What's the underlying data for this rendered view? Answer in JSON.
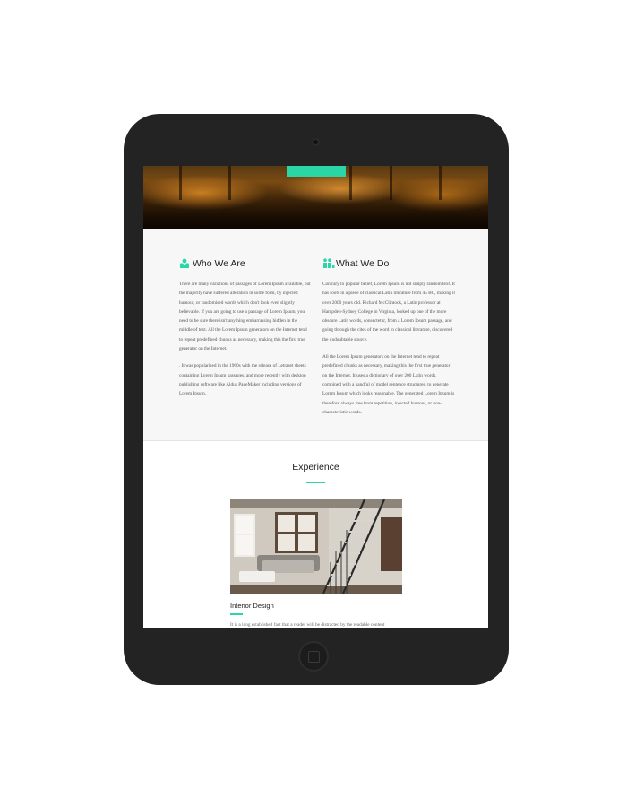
{
  "colors": {
    "accent": "#2bd6a6",
    "device": "#232323",
    "section_bg": "#f7f7f7"
  },
  "sections": {
    "who_we_are": {
      "title": "Who We Are",
      "icon": "person-icon",
      "paragraphs": [
        "There are many variations of passages of Lorem Ipsum available, but the majority have suffered alteration in some form, by injected humour, or randomised words which don't look even slightly believable. If you are going to use a passage of Lorem Ipsum, you need to be sure there isn't anything embarrassing hidden in the middle of text. All the Lorem Ipsum generators on the Internet tend to repeat predefined chunks as necessary, making this the first true generator on the Internet.",
        ". It was popularised in the 1960s with the release of Letraset sheets containing Lorem Ipsum passages, and more recently with desktop publishing software like Aldus PageMaker including versions of Lorem Ipsum."
      ]
    },
    "what_we_do": {
      "title": "What We Do",
      "icon": "team-icon",
      "paragraphs": [
        "Contrary to popular belief, Lorem Ipsum is not simply random text. It has roots in a piece of classical Latin literature from 45 BC, making it over 2000 years old. Richard McClintock, a Latin professor at Hampden-Sydney College in Virginia, looked up one of the more obscure Latin words, consectetur, from a Lorem Ipsum passage, and going through the cites of the word in classical literature, discovered the undoubtable source.",
        "All the Lorem Ipsum generators on the Internet tend to repeat predefined chunks as necessary, making this the first true generator on the Internet. It uses a dictionary of over 200 Latin words, combined with a handful of model sentence structures, to generate Lorem Ipsum which looks reasonable. The generated Lorem Ipsum is therefore always free from repetition, injected humour, or non-characteristic words."
      ]
    },
    "experience": {
      "title": "Experience",
      "card": {
        "title": "Interior Design",
        "text": "It is a long established fact that a reader will be distracted by the readable content"
      }
    }
  }
}
